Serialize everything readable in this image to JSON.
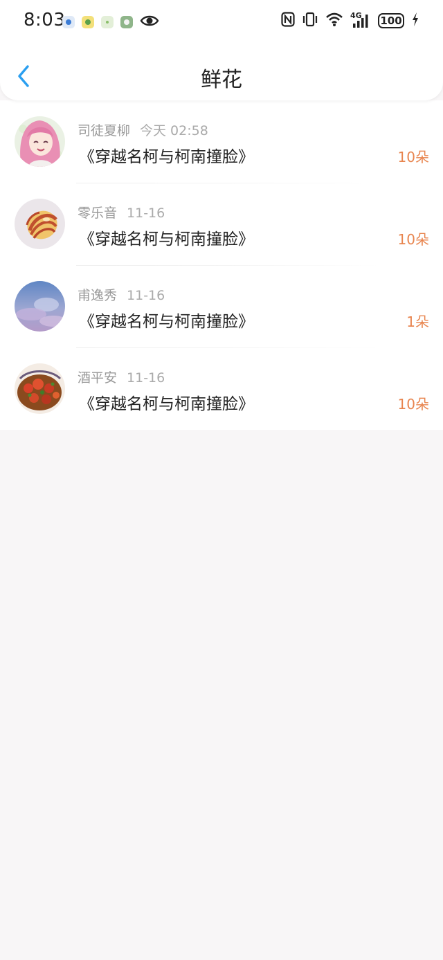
{
  "status_bar": {
    "time": "8:03",
    "network": "4G",
    "battery": "100"
  },
  "header": {
    "title": "鲜花"
  },
  "colors": {
    "accent_back": "#2a9ff0",
    "amount": "#e8854f",
    "muted_text": "#999999"
  },
  "list": [
    {
      "name": "司徒夏柳",
      "time": "今天 02:58",
      "book": "《穿越名柯与柯南撞脸》",
      "amount": "10朵",
      "avatar": "anime-girl-pink-hair"
    },
    {
      "name": "零乐音",
      "time": "11-16",
      "book": "《穿越名柯与柯南撞脸》",
      "amount": "10朵",
      "avatar": "striped-shell"
    },
    {
      "name": "甫逸秀",
      "time": "11-16",
      "book": "《穿越名柯与柯南撞脸》",
      "amount": "1朵",
      "avatar": "purple-sky-clouds"
    },
    {
      "name": "酒平安",
      "time": "11-16",
      "book": "《穿越名柯与柯南撞脸》",
      "amount": "10朵",
      "avatar": "crayfish-dish"
    }
  ]
}
